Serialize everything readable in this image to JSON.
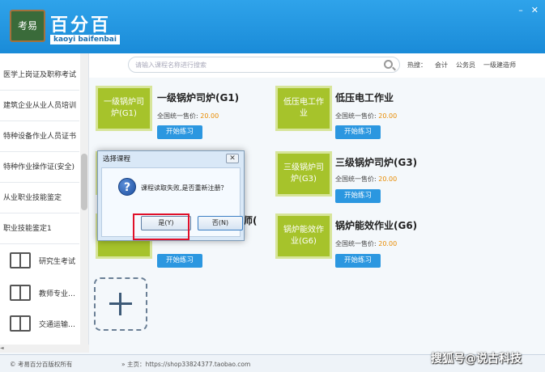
{
  "header": {
    "logo_badge": "考易",
    "logo_title": "百分百",
    "logo_subtitle": "kaoyi baifenbai",
    "win_minimize": "–",
    "win_close": "✕"
  },
  "search": {
    "placeholder": "请输入课程名称进行搜索"
  },
  "hot": {
    "label": "热搜：",
    "items": [
      "会计",
      "公务员",
      "一级建造师"
    ]
  },
  "sidebar": {
    "items": [
      "医学上岗证及职称考试",
      "建筑企业从业人员培训",
      "特种设备作业人员证书",
      "特种作业操作证(安全)",
      "从业职业技能鉴定",
      "职业技能鉴定1"
    ],
    "sub_items": [
      "研究生考试",
      "教师专业…",
      "交通运输…"
    ],
    "hscroll_left": "◄"
  },
  "cards": [
    {
      "tile": "一级锅炉司炉(G1)",
      "title": "一级锅炉司炉(G1)",
      "price_label": "全国统一售价:",
      "price": "20.00",
      "button": "开始练习"
    },
    {
      "tile": "低压电工作业",
      "title": "低压电工作业",
      "price_label": "全国统一售价:",
      "price": "20.00",
      "button": "开始练习"
    },
    {
      "tile": "三级锅炉司炉(G3)",
      "title": "三级锅炉司炉(G3)",
      "price_label": "全国统一售价:",
      "price": "20.00",
      "button": "开始练习"
    },
    {
      "tile": "锅炉能效作业(G6)",
      "title": "锅炉能效作业(G6)",
      "price_label": "全国统一售价:",
      "price": "20.00",
      "button": "开始练习"
    },
    {
      "tile": "",
      "title": "师(",
      "price_label": "",
      "price": "",
      "button": "开始练习"
    }
  ],
  "dialog": {
    "title": "选择课程",
    "close": "✕",
    "message": "课程读取失败,是否重新注册？",
    "yes": "是(Y)",
    "no": "否(N)"
  },
  "footer": {
    "copyright": "© 考易百分百版权所有",
    "home": "» 主页：https://shop33824377.taobao.com"
  },
  "watermark": "搜狐号@说古科技"
}
